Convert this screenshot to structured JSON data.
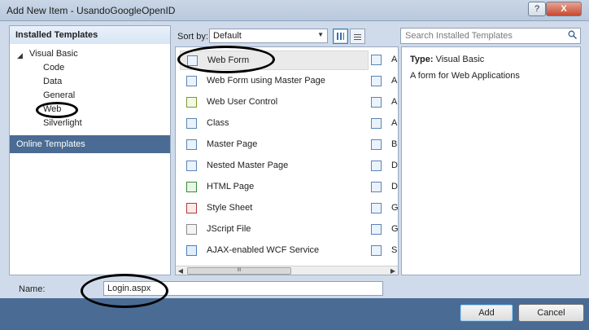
{
  "window": {
    "title": "Add New Item - UsandoGoogleOpenID",
    "help_label": "?",
    "close_label": "X"
  },
  "left_panel": {
    "installed_header": "Installed Templates",
    "tree_root": "Visual Basic",
    "tree_items": [
      "Code",
      "Data",
      "General",
      "Web",
      "Silverlight"
    ],
    "online_header": "Online Templates"
  },
  "toolbar": {
    "sort_label": "Sort by:",
    "sort_value": "Default",
    "search_placeholder": "Search Installed Templates"
  },
  "templates": [
    {
      "label": "Web Form",
      "icon": "web-form-icon"
    },
    {
      "label": "Web Form using Master Page",
      "icon": "web-form-master-icon"
    },
    {
      "label": "Web User Control",
      "icon": "user-control-icon"
    },
    {
      "label": "Class",
      "icon": "class-icon"
    },
    {
      "label": "Master Page",
      "icon": "master-page-icon"
    },
    {
      "label": "Nested Master Page",
      "icon": "nested-master-icon"
    },
    {
      "label": "HTML Page",
      "icon": "html-page-icon"
    },
    {
      "label": "Style Sheet",
      "icon": "style-sheet-icon"
    },
    {
      "label": "JScript File",
      "icon": "jscript-icon"
    },
    {
      "label": "AJAX-enabled WCF Service",
      "icon": "wcf-service-icon"
    }
  ],
  "templates_col2": [
    {
      "label": "AS",
      "icon": "template-icon"
    },
    {
      "label": "AS",
      "icon": "template-icon"
    },
    {
      "label": "AS",
      "icon": "template-icon"
    },
    {
      "label": "Au",
      "icon": "template-icon"
    },
    {
      "label": "Br",
      "icon": "template-icon"
    },
    {
      "label": "Do",
      "icon": "template-icon"
    },
    {
      "label": "Dy",
      "icon": "template-icon"
    },
    {
      "label": "Ge",
      "icon": "template-icon"
    },
    {
      "label": "Gl",
      "icon": "template-icon"
    },
    {
      "label": "Sit",
      "icon": "template-icon"
    }
  ],
  "details": {
    "type_label": "Type:",
    "type_value": "Visual Basic",
    "description": "A form for Web Applications"
  },
  "name_field": {
    "label": "Name:",
    "value": "Login.aspx"
  },
  "buttons": {
    "add": "Add",
    "cancel": "Cancel"
  },
  "colors": {
    "frame": "#cfdbea",
    "selected_bar": "#4a6b93",
    "close_button": "#c74a31"
  }
}
